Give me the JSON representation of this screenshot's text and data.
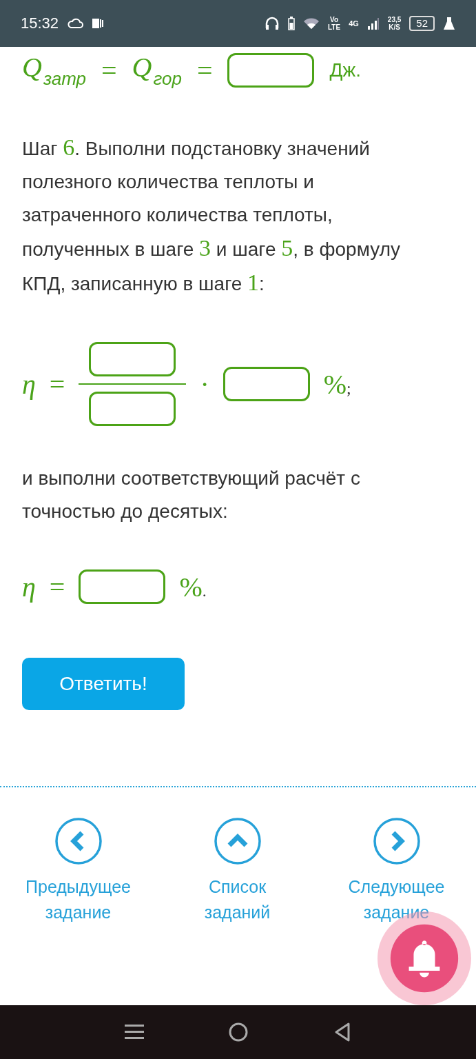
{
  "status_bar": {
    "time": "15:32",
    "volte_top": "Vo",
    "volte_bottom": "LTE",
    "network": "4G",
    "speed_value": "23,5",
    "speed_unit": "K/S",
    "battery": "52"
  },
  "formula_heat": {
    "symbol_1": "Q",
    "subscript_1": "затр",
    "equals_1": "=",
    "symbol_2": "Q",
    "subscript_2": "гор",
    "equals_2": "=",
    "unit": "Дж."
  },
  "step_text": [
    {
      "kind": "text",
      "text": "Шаг "
    },
    {
      "kind": "number",
      "text": "6"
    },
    {
      "kind": "text",
      "text": ". Выполни подстановку значений полезного количества теплоты и затраченного количества теплоты, полученных в шаге "
    },
    {
      "kind": "number",
      "text": "3"
    },
    {
      "kind": "text",
      "text": " и шаге "
    },
    {
      "kind": "number",
      "text": "5"
    },
    {
      "kind": "text",
      "text": ", в формулу КПД, записанную в шаге "
    },
    {
      "kind": "number",
      "text": "1"
    },
    {
      "kind": "text",
      "text": ":"
    }
  ],
  "formula_efficiency": {
    "symbol": "η",
    "equals": "=",
    "times": "·",
    "percent": "%",
    "end": ";"
  },
  "calc_text": "и выполни соответствующий расчёт с точностью до десятых:",
  "formula_result": {
    "symbol": "η",
    "equals": "=",
    "percent": "%",
    "end": "."
  },
  "answer_button": "Ответить!",
  "nav": [
    {
      "kind": "prev",
      "lines": [
        "Предыдущее",
        "задание"
      ]
    },
    {
      "kind": "list",
      "lines": [
        "Список",
        "заданий"
      ]
    },
    {
      "kind": "next",
      "lines": [
        "Следующее",
        "задание"
      ]
    }
  ]
}
